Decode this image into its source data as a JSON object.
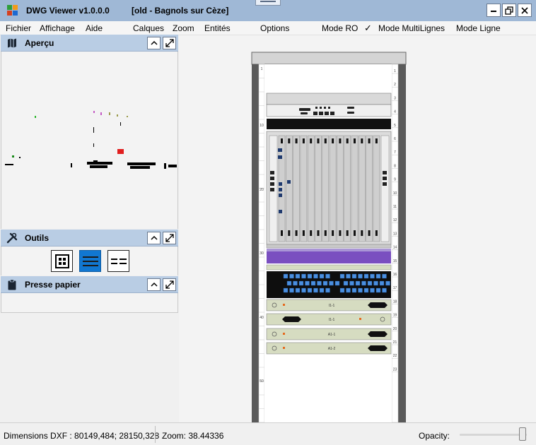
{
  "window": {
    "app_title": "DWG Viewer v1.0.0.0",
    "document_title": "[old - Bagnols sur Cèze]",
    "minimize_label": "minimize",
    "restore_label": "restore",
    "close_label": "close"
  },
  "menu": {
    "fichier": "Fichier",
    "affichage": "Affichage",
    "aide": "Aide",
    "calques": "Calques",
    "zoom": "Zoom",
    "entites": "Entités",
    "options": "Options",
    "mode_ro": "Mode RO",
    "mode_multilignes": "Mode MultiLignes",
    "mode_multilignes_checked": true,
    "mode_ligne": "Mode Ligne"
  },
  "panels": {
    "apercu": {
      "title": "Aperçu",
      "icon": "map-icon"
    },
    "outils": {
      "title": "Outils",
      "icon": "tools-icon",
      "tools": [
        "grid-view-icon",
        "lines-view-icon",
        "dashed-lines-view-icon"
      ],
      "active_tool": 1
    },
    "presse_papier": {
      "title": "Presse papier",
      "icon": "clipboard-icon"
    }
  },
  "drawing": {
    "left_numbers": [
      "1",
      "10",
      "20",
      "30",
      "40",
      "50"
    ],
    "right_numbers": [
      "1",
      "2",
      "3",
      "4",
      "5",
      "6",
      "7",
      "8",
      "9",
      "10",
      "11",
      "12",
      "13",
      "14",
      "15",
      "16",
      "17",
      "18",
      "19",
      "20",
      "21",
      "22",
      "23"
    ],
    "module_labels": [
      "I1-1",
      "I1-1",
      "A1-1",
      "A1-2"
    ]
  },
  "status": {
    "dimensions": "Dimensions DXF : 80149,484; 28150,328",
    "zoom": "Zoom: 38.44336",
    "opacity_label": "Opacity:",
    "opacity_value": 1.0
  },
  "colors": {
    "titlebar": "#9fb8d6",
    "panel_header": "#b9cde4",
    "active_tool": "#1177d1",
    "rack_frame": "#5a5a5a",
    "purple_band": "#7a4fc0",
    "port_blue": "#4a8fe0",
    "module_green": "#d6dcc1"
  }
}
